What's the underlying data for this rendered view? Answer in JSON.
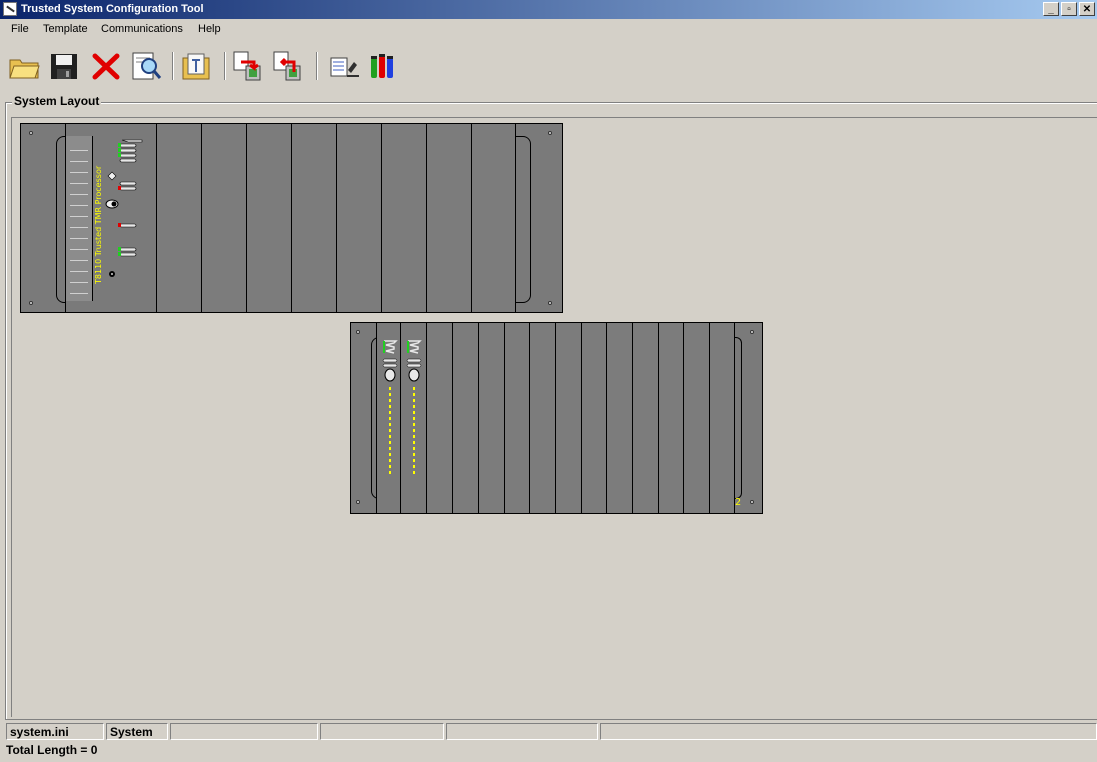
{
  "window": {
    "title": "Trusted System Configuration Tool",
    "buttons": {
      "minimize": "_",
      "restore": "▫",
      "close": "✕"
    }
  },
  "menu": {
    "items": [
      "File",
      "Template",
      "Communications",
      "Help"
    ]
  },
  "toolbar": {
    "buttons": [
      {
        "name": "open-icon"
      },
      {
        "name": "save-icon"
      },
      {
        "name": "delete-icon"
      },
      {
        "name": "preview-icon"
      },
      {
        "name": "template-icon"
      },
      {
        "name": "download-icon"
      },
      {
        "name": "upload-icon"
      },
      {
        "name": "edit-icon"
      },
      {
        "name": "tools-icon"
      }
    ]
  },
  "layout": {
    "group_label": "System Layout",
    "racks": [
      {
        "id": "rack-1",
        "processor_label": "T8110 Trusted TMR Processor",
        "slot_count": 8
      },
      {
        "id": "rack-2",
        "number": "2",
        "slot_count": 14
      }
    ]
  },
  "status": {
    "file": "system.ini",
    "system": "System",
    "field3": "",
    "field4": "",
    "field5": "",
    "field6": "",
    "total_length": "Total Length = 0"
  }
}
